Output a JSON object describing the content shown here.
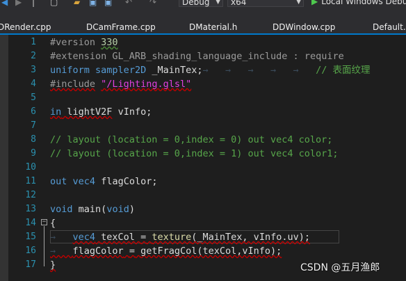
{
  "toolbar": {
    "config": "Debug",
    "platform": "x64",
    "run_label": "Local Windows Debu"
  },
  "tabs": [
    {
      "label": "DRender.cpp"
    },
    {
      "label": "DCamFrame.cpp"
    },
    {
      "label": "DMaterial.h"
    },
    {
      "label": "DDWindow.cpp"
    },
    {
      "label": "Default.v"
    }
  ],
  "editor": {
    "lines": [
      {
        "n": "1",
        "text": "#version 330"
      },
      {
        "n": "2",
        "text": "#extension GL_ARB_shading_language_include : require"
      },
      {
        "n": "3",
        "text": "uniform sampler2D _MainTex;     // 表面纹理"
      },
      {
        "n": "4",
        "text": "#include \"/Lighting.glsl\""
      },
      {
        "n": "5",
        "text": ""
      },
      {
        "n": "6",
        "text": "in lightV2F vInfo;"
      },
      {
        "n": "7",
        "text": ""
      },
      {
        "n": "8",
        "text": "// layout (location = 0,index = 0) out vec4 color;"
      },
      {
        "n": "9",
        "text": "// layout (location = 0,index = 1) out vec4 color1;"
      },
      {
        "n": "10",
        "text": ""
      },
      {
        "n": "11",
        "text": "out vec4 flagColor;"
      },
      {
        "n": "12",
        "text": ""
      },
      {
        "n": "13",
        "text": "void main(void)"
      },
      {
        "n": "14",
        "text": "{"
      },
      {
        "n": "15",
        "text": "    vec4 texCol = texture(_MainTex, vInfo.uv);"
      },
      {
        "n": "16",
        "text": "    flagColor = getFragCol(texCol,vInfo);"
      },
      {
        "n": "17",
        "text": "}"
      }
    ],
    "tokens": {
      "l1_a": "#version",
      "l1_b": "330",
      "l2_a": "#extension",
      "l2_b": "GL_ARB_shading_language_include",
      "l2_c": ":",
      "l2_d": "require",
      "l3_a": "uniform",
      "l3_b": "sampler2D",
      "l3_c": "_MainTex;",
      "l3_d": "// 表面纹理",
      "l4_a": "#include",
      "l4_b": "\"/Lighting.glsl\"",
      "l6_a": "in",
      "l6_b": "lightV2F",
      "l6_c": "vInfo;",
      "l8": "// layout (location = 0,index = 0) out vec4 color;",
      "l9": "// layout (location = 0,index = 1) out vec4 color1;",
      "l11_a": "out",
      "l11_b": "vec4",
      "l11_c": "flagColor;",
      "l13_a": "void",
      "l13_b": "main",
      "l13_c": "(",
      "l13_d": "void",
      "l13_e": ")",
      "l14": "{",
      "l15_a": "vec4",
      "l15_b": "texCol",
      "l15_c": "=",
      "l15_d": "texture",
      "l15_e": "(_MainTex, vInfo.uv);",
      "l16_a": "flagColor",
      "l16_b": "=",
      "l16_c": "getFragCol",
      "l16_d": "(texCol,vInfo);",
      "l17": "}"
    }
  },
  "watermark": "CSDN @五月渔郎",
  "colors": {
    "background": "#1e1e1e",
    "line_number": "#2b91af",
    "keyword": "#569cd6",
    "comment": "#57a64a",
    "string": "#d69d85",
    "error_squiggle": "#c00000"
  }
}
